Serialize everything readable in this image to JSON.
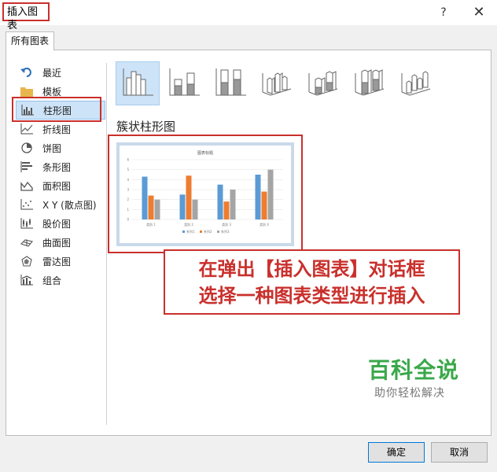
{
  "window": {
    "title": "插入图表",
    "help_label": "?",
    "close_label": "✕"
  },
  "tabs": [
    {
      "label": "所有图表"
    }
  ],
  "sidebar": {
    "items": [
      {
        "label": "最近",
        "icon": "undo-icon"
      },
      {
        "label": "模板",
        "icon": "folder-icon"
      },
      {
        "label": "柱形图",
        "icon": "column-chart-icon",
        "selected": true
      },
      {
        "label": "折线图",
        "icon": "line-chart-icon"
      },
      {
        "label": "饼图",
        "icon": "pie-chart-icon"
      },
      {
        "label": "条形图",
        "icon": "bar-chart-icon"
      },
      {
        "label": "面积图",
        "icon": "area-chart-icon"
      },
      {
        "label": "X Y (散点图)",
        "icon": "scatter-chart-icon"
      },
      {
        "label": "股价图",
        "icon": "stock-chart-icon"
      },
      {
        "label": "曲面图",
        "icon": "surface-chart-icon"
      },
      {
        "label": "雷达图",
        "icon": "radar-chart-icon"
      },
      {
        "label": "组合",
        "icon": "combo-chart-icon"
      }
    ]
  },
  "subtypes": {
    "icons": [
      "clustered-column-icon",
      "stacked-column-icon",
      "percent-stacked-column-icon",
      "3d-clustered-column-icon",
      "3d-stacked-column-icon",
      "3d-percent-stacked-column-icon",
      "3d-column-icon"
    ],
    "selected_index": 0,
    "selected_label": "簇状柱形图"
  },
  "preview": {
    "chart_data": {
      "type": "bar",
      "title": "图表标题",
      "categories": [
        "类别 1",
        "类别 2",
        "类别 3",
        "类别 4"
      ],
      "series": [
        {
          "name": "系列1",
          "values": [
            4.3,
            2.5,
            3.5,
            4.5
          ],
          "color": "#5b9bd5"
        },
        {
          "name": "系列2",
          "values": [
            2.4,
            4.4,
            1.8,
            2.8
          ],
          "color": "#ed7d31"
        },
        {
          "name": "系列3",
          "values": [
            2.0,
            2.0,
            3.0,
            5.0
          ],
          "color": "#a5a5a5"
        }
      ],
      "ylim": [
        0,
        6
      ],
      "yticks": [
        "0",
        "1",
        "2",
        "3",
        "4",
        "5",
        "6"
      ],
      "grid": true,
      "legend": "bottom"
    }
  },
  "annotation": {
    "line1": "在弹出【插入图表】对话框",
    "line2": "选择一种图表类型进行插入"
  },
  "watermark": {
    "main": "百科全说",
    "sub": "助你轻松解决"
  },
  "buttons": {
    "ok": "确定",
    "cancel": "取消"
  }
}
